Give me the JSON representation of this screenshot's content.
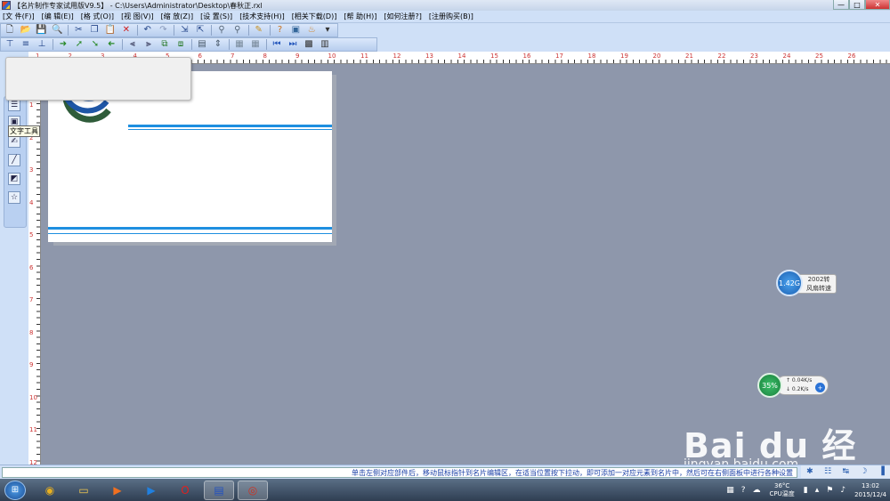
{
  "window": {
    "title": "【名片制作专家试用版V9.5】 - C:\\Users\\Administrator\\Desktop\\春秋正.rxl",
    "minimize": "—",
    "maximize": "□",
    "close": "✕"
  },
  "menu": [
    "[文 件(F)]",
    "[编 辑(E)]",
    "[格 式(O)]",
    "[视 图(V)]",
    "[缩 放(Z)]",
    "[设 置(S)]",
    "[技术支持(H)]",
    "[相关下载(D)]",
    "[帮 助(H)]",
    "[如何注册?]",
    "[注册购买(B)]"
  ],
  "toolbar1": [
    {
      "name": "new-icon",
      "glyph": "🗋",
      "color": "#333333"
    },
    {
      "name": "open-icon",
      "glyph": "📂",
      "color": "#c89a20"
    },
    {
      "name": "save-icon",
      "glyph": "💾",
      "color": "#2c4fa0"
    },
    {
      "name": "print-preview-icon",
      "glyph": "🔍",
      "color": "#446688"
    },
    {
      "name": "sep"
    },
    {
      "name": "cut-icon",
      "glyph": "✂",
      "color": "#224488"
    },
    {
      "name": "copy-icon",
      "glyph": "❐",
      "color": "#224488"
    },
    {
      "name": "paste-icon",
      "glyph": "📋",
      "color": "#8888aa"
    },
    {
      "name": "delete-icon",
      "glyph": "✕",
      "color": "#d02020"
    },
    {
      "name": "sep"
    },
    {
      "name": "undo-icon",
      "glyph": "↶",
      "color": "#224488"
    },
    {
      "name": "redo-icon",
      "glyph": "↷",
      "color": "#8899bb"
    },
    {
      "name": "sep"
    },
    {
      "name": "import-icon",
      "glyph": "⇲",
      "color": "#224488"
    },
    {
      "name": "export-icon",
      "glyph": "⇱",
      "color": "#224488"
    },
    {
      "name": "sep"
    },
    {
      "name": "zoom-in-icon",
      "glyph": "⚲",
      "color": "#556677"
    },
    {
      "name": "zoom-out-icon",
      "glyph": "⚲",
      "color": "#556677"
    },
    {
      "name": "sep"
    },
    {
      "name": "pencil-icon",
      "glyph": "✎",
      "color": "#c8901c"
    },
    {
      "name": "sep"
    },
    {
      "name": "help-icon",
      "glyph": "?",
      "color": "#c8701c"
    },
    {
      "name": "image-icon",
      "glyph": "▣",
      "color": "#336699"
    },
    {
      "name": "paint-icon",
      "glyph": "♨",
      "color": "#d08020"
    },
    {
      "name": "dropdown-icon",
      "glyph": "▾",
      "color": "#333333"
    }
  ],
  "toolbar2": [
    {
      "name": "align-top-icon",
      "glyph": "⊤",
      "color": "#224488"
    },
    {
      "name": "align-middle-icon",
      "glyph": "≡",
      "color": "#224488"
    },
    {
      "name": "align-bottom-icon",
      "glyph": "⊥",
      "color": "#224488"
    },
    {
      "name": "sep"
    },
    {
      "name": "arrow-right-icon",
      "glyph": "➜",
      "color": "#2a8a2a"
    },
    {
      "name": "arrow-up-right-icon",
      "glyph": "➚",
      "color": "#2a8a2a"
    },
    {
      "name": "arrow-down-right-icon",
      "glyph": "➘",
      "color": "#2a8a2a"
    },
    {
      "name": "arrow-left-icon",
      "glyph": "➜",
      "color": "#2a8a2a"
    },
    {
      "name": "sep"
    },
    {
      "name": "align-left-icon",
      "glyph": "⫷",
      "color": "#222244"
    },
    {
      "name": "align-right-icon",
      "glyph": "⫸",
      "color": "#222244"
    },
    {
      "name": "group-icon",
      "glyph": "⧉",
      "color": "#2a7a2a"
    },
    {
      "name": "ungroup-icon",
      "glyph": "⧈",
      "color": "#2a7a2a"
    },
    {
      "name": "sep"
    },
    {
      "name": "lock-icon",
      "glyph": "▤",
      "color": "#445566"
    },
    {
      "name": "distribute-icon",
      "glyph": "⇕",
      "color": "#445566"
    },
    {
      "name": "sep"
    },
    {
      "name": "layer-back-icon",
      "glyph": "▦",
      "color": "#778899"
    },
    {
      "name": "layer-front-icon",
      "glyph": "▦",
      "color": "#778899"
    },
    {
      "name": "sep"
    },
    {
      "name": "first-page-icon",
      "glyph": "⏮",
      "color": "#2255bb"
    },
    {
      "name": "next-page-icon",
      "glyph": "⏭",
      "color": "#2255bb"
    },
    {
      "name": "grid-icon",
      "glyph": "▩",
      "color": "#333333"
    },
    {
      "name": "table-icon",
      "glyph": "▥",
      "color": "#333333"
    }
  ],
  "hruler_numbers": [
    "1",
    "2",
    "3",
    "4",
    "5",
    "6",
    "7",
    "8",
    "9",
    "10",
    "11",
    "12",
    "13",
    "14",
    "15",
    "16",
    "17",
    "18",
    "19",
    "20",
    "21",
    "22",
    "23",
    "24",
    "25",
    "26"
  ],
  "vruler_numbers": [
    "1",
    "2",
    "3",
    "4",
    "5",
    "6",
    "7",
    "8",
    "9",
    "10",
    "11",
    "12"
  ],
  "left_tools": [
    {
      "name": "list-tool-icon",
      "glyph": "☰"
    },
    {
      "name": "image-tool-icon",
      "glyph": "▣"
    },
    {
      "name": "text-tool-icon",
      "glyph": "✍"
    },
    {
      "name": "line-tool-icon",
      "glyph": "╱"
    },
    {
      "name": "rect-tool-icon",
      "glyph": "◩"
    },
    {
      "name": "star-tool-icon",
      "glyph": "☆"
    }
  ],
  "tooltip": "文字工具",
  "gadget_fan": {
    "value": "1.42G",
    "label1": "2002转",
    "label2": "风扇转速"
  },
  "gadget_net": {
    "percent": "35%",
    "up": "↑ 0.04K/s",
    "down": "↓ 0.2K/s",
    "plus": "+"
  },
  "watermark": {
    "logo": "Bai du 经验",
    "url": "jingyan.baidu.com"
  },
  "status_message": "单击左侧对应部件后，移动鼠标指针到名片编辑区，在适当位置按下拉动，即可添加一对应元素到名片中，然后可在右侧面板中进行各种设置",
  "status_icons": [
    "✱",
    "☷",
    "↹",
    "☽",
    "▐"
  ],
  "taskbar": {
    "start": "⊞",
    "apps": [
      {
        "name": "chrome-taskbar-icon",
        "glyph": "◉",
        "color": "#e8b020"
      },
      {
        "name": "folder-taskbar-icon",
        "glyph": "▭",
        "color": "#f0c850"
      },
      {
        "name": "media-taskbar-icon",
        "glyph": "▶",
        "color": "#f07020"
      },
      {
        "name": "player-taskbar-icon",
        "glyph": "▶",
        "color": "#2080e0"
      },
      {
        "name": "opera-taskbar-icon",
        "glyph": "O",
        "color": "#e02020"
      },
      {
        "name": "card-app-taskbar-icon",
        "glyph": "▤",
        "color": "#2050c0"
      },
      {
        "name": "target-taskbar-icon",
        "glyph": "◎",
        "color": "#d03020"
      }
    ]
  },
  "tray": {
    "temp": "36°C",
    "temp_label": "CPU温度",
    "time": "13:02",
    "date": "2015/12/4"
  }
}
